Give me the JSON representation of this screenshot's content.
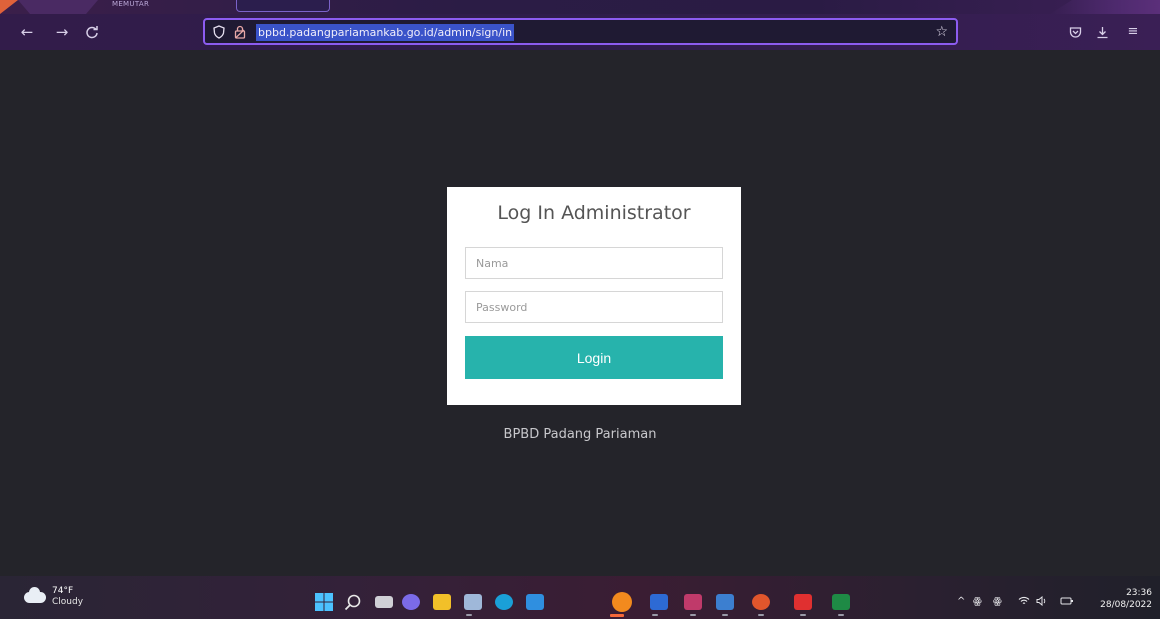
{
  "browser": {
    "tab_label": "MEMUTAR",
    "nav": {
      "back_icon": "←",
      "forward_icon": "→",
      "reload_icon": "C"
    },
    "url": "bpbd.padangpariamankab.go.id/admin/sign/in",
    "icons": {
      "shield": "⬡",
      "lock": "🔒",
      "star": "☆",
      "pocket": "◡",
      "download": "⤓",
      "menu": "≡"
    }
  },
  "login": {
    "title": "Log In Administrator",
    "username_placeholder": "Nama",
    "password_placeholder": "Password",
    "submit_label": "Login"
  },
  "footer": {
    "text": "BPBD Padang Pariaman"
  },
  "taskbar": {
    "weather": {
      "temp": "74°F",
      "condition": "Cloudy"
    },
    "tray": {
      "chevron": "^",
      "wifi": "wifi",
      "volume": "volume"
    },
    "clock": {
      "time": "23:36",
      "date": "28/08/2022"
    }
  },
  "colors": {
    "accent": "#27b3ac",
    "url_border": "#8c5cf0",
    "url_highlight": "#3a53c9",
    "page_bg": "#24242a"
  }
}
